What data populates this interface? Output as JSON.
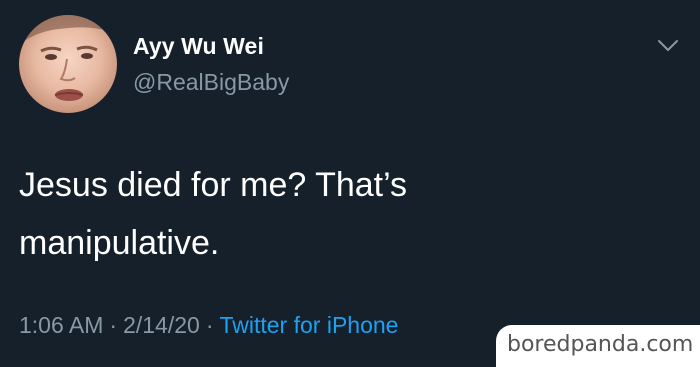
{
  "tweet": {
    "avatar_icon": "user-avatar-photo",
    "display_name": "Ayy Wu Wei",
    "handle": "@RealBigBaby",
    "menu_icon": "chevron-down-icon",
    "text_lines": [
      "Jesus died for me? That’s",
      "manipulative."
    ],
    "time": "1:06 AM",
    "date": "2/14/20",
    "separator": "·",
    "source": "Twitter for iPhone"
  },
  "watermark": {
    "text": "boredpanda.com"
  },
  "colors": {
    "background": "#15202b",
    "name": "#ffffff",
    "secondary": "#8899a6",
    "link": "#1da1f2"
  }
}
